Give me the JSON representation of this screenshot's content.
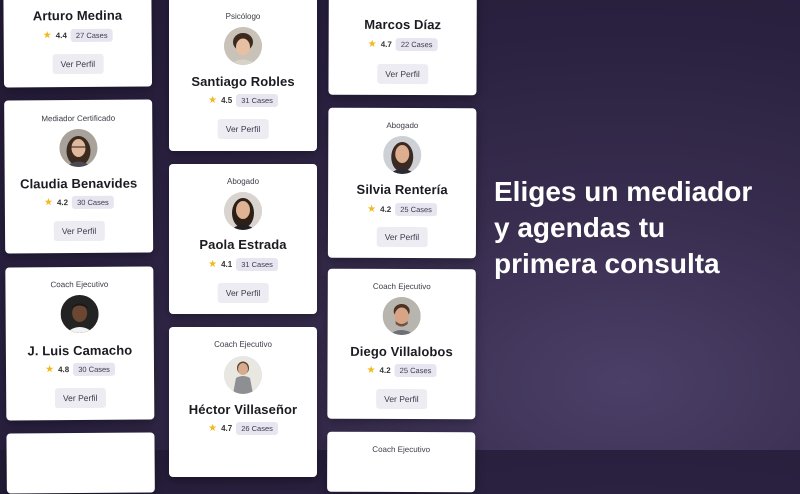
{
  "headline": {
    "line1": "Eliges un mediador",
    "line2": "y agendas tu",
    "line3": "primera consulta"
  },
  "button_label": "Ver Perfil",
  "star_icon": "★",
  "cards": {
    "arturo": {
      "role": "",
      "name": "Arturo Medina",
      "rating": "4.4",
      "cases": "27 Cases"
    },
    "claudia": {
      "role": "Mediador Certificado",
      "name": "Claudia Benavides",
      "rating": "4.2",
      "cases": "30 Cases"
    },
    "jluis": {
      "role": "Coach Ejecutivo",
      "name": "J. Luis Camacho",
      "rating": "4.8",
      "cases": "30 Cases"
    },
    "santiago": {
      "role": "Psicólogo",
      "name": "Santiago Robles",
      "rating": "4.5",
      "cases": "31 Cases"
    },
    "paola": {
      "role": "Abogado",
      "name": "Paola Estrada",
      "rating": "4.1",
      "cases": "31 Cases"
    },
    "hector": {
      "role": "Coach Ejecutivo",
      "name": "Héctor Villaseñor",
      "rating": "4.7",
      "cases": "26 Cases"
    },
    "marcos": {
      "role": "",
      "name": "Marcos Díaz",
      "rating": "4.7",
      "cases": "22 Cases"
    },
    "silvia": {
      "role": "Abogado",
      "name": "Silvia Rentería",
      "rating": "4.2",
      "cases": "25 Cases"
    },
    "diego": {
      "role": "Coach Ejecutivo",
      "name": "Diego Villalobos",
      "rating": "4.2",
      "cases": "25 Cases"
    },
    "bottom": {
      "role": "Coach Ejecutivo"
    }
  }
}
